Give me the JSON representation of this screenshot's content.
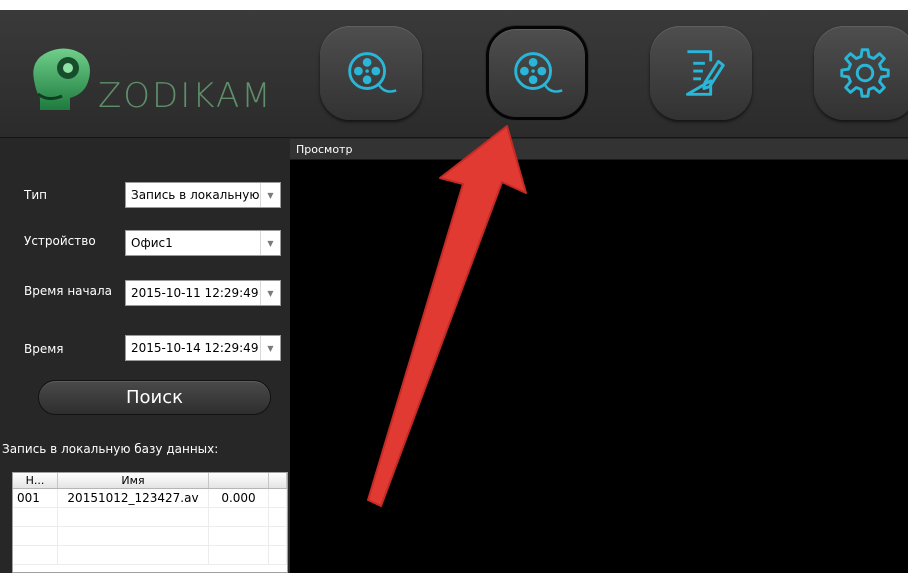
{
  "brand": {
    "name": "ZODIKAM"
  },
  "nav": [
    {
      "icon": "film-reel-icon"
    },
    {
      "icon": "film-reel-icon",
      "active": true
    },
    {
      "icon": "edit-document-icon"
    },
    {
      "icon": "gear-icon"
    }
  ],
  "form": {
    "type_label": "Тип",
    "type_value": "Запись в локальную базу данных",
    "device_label": "Устройство",
    "device_value": "Офис1",
    "start_label": "Время начала",
    "start_value": "2015-10-11 12:29:49",
    "end_label": "Время",
    "end_value": "2015-10-14 12:29:49"
  },
  "search_button": "Поиск",
  "db_label": "Запись в локальную базу данных:",
  "table": {
    "headers": [
      "Н...",
      "Имя",
      "",
      ""
    ],
    "rows": [
      [
        "001",
        "20151012_123427.av",
        "0.000"
      ]
    ]
  },
  "preview": {
    "title": "Просмотр"
  },
  "colors": {
    "accent": "#29b6d8",
    "brand_green": "#2f9a57",
    "annotation_arrow": "#e03a33"
  }
}
